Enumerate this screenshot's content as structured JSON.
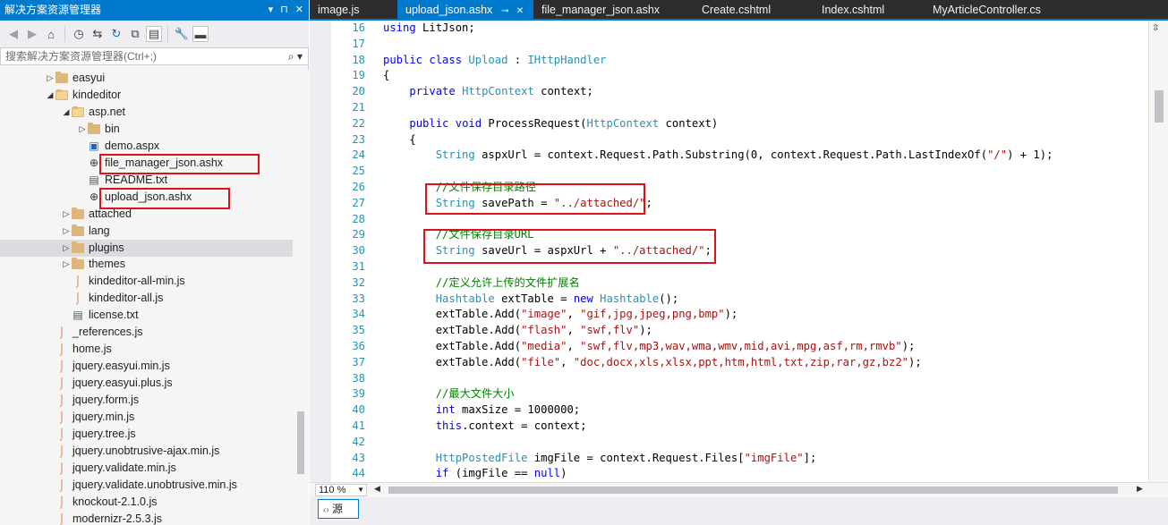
{
  "solution_explorer": {
    "title": "解决方案资源管理器",
    "title_buttons": [
      "▾",
      "⊓",
      "✕"
    ],
    "search_placeholder": "搜索解决方案资源管理器(Ctrl+;)",
    "tree": [
      {
        "label": "easyui",
        "kind": "folder",
        "indent": 3,
        "arrow": "▷"
      },
      {
        "label": "kindeditor",
        "kind": "folder-open",
        "indent": 3,
        "arrow": "◢"
      },
      {
        "label": "asp.net",
        "kind": "folder-open",
        "indent": 4,
        "arrow": "◢"
      },
      {
        "label": "bin",
        "kind": "folder",
        "indent": 5,
        "arrow": "▷"
      },
      {
        "label": "demo.aspx",
        "kind": "aspx",
        "indent": 5,
        "arrow": ""
      },
      {
        "label": "file_manager_json.ashx",
        "kind": "ashx",
        "indent": 5,
        "arrow": "",
        "highlight": true
      },
      {
        "label": "README.txt",
        "kind": "txt",
        "indent": 5,
        "arrow": ""
      },
      {
        "label": "upload_json.ashx",
        "kind": "ashx",
        "indent": 5,
        "arrow": "",
        "highlight": true
      },
      {
        "label": "attached",
        "kind": "folder",
        "indent": 4,
        "arrow": "▷"
      },
      {
        "label": "lang",
        "kind": "folder",
        "indent": 4,
        "arrow": "▷"
      },
      {
        "label": "plugins",
        "kind": "folder",
        "indent": 4,
        "arrow": "▷",
        "selected": true
      },
      {
        "label": "themes",
        "kind": "folder",
        "indent": 4,
        "arrow": "▷"
      },
      {
        "label": "kindeditor-all-min.js",
        "kind": "js",
        "indent": 4,
        "arrow": ""
      },
      {
        "label": "kindeditor-all.js",
        "kind": "js",
        "indent": 4,
        "arrow": ""
      },
      {
        "label": "license.txt",
        "kind": "txt",
        "indent": 4,
        "arrow": ""
      },
      {
        "label": "_references.js",
        "kind": "js",
        "indent": 3,
        "arrow": ""
      },
      {
        "label": "home.js",
        "kind": "js",
        "indent": 3,
        "arrow": ""
      },
      {
        "label": "jquery.easyui.min.js",
        "kind": "js",
        "indent": 3,
        "arrow": ""
      },
      {
        "label": "jquery.easyui.plus.js",
        "kind": "js",
        "indent": 3,
        "arrow": ""
      },
      {
        "label": "jquery.form.js",
        "kind": "js",
        "indent": 3,
        "arrow": ""
      },
      {
        "label": "jquery.min.js",
        "kind": "js",
        "indent": 3,
        "arrow": ""
      },
      {
        "label": "jquery.tree.js",
        "kind": "js",
        "indent": 3,
        "arrow": ""
      },
      {
        "label": "jquery.unobtrusive-ajax.min.js",
        "kind": "js",
        "indent": 3,
        "arrow": ""
      },
      {
        "label": "jquery.validate.min.js",
        "kind": "js",
        "indent": 3,
        "arrow": ""
      },
      {
        "label": "jquery.validate.unobtrusive.min.js",
        "kind": "js",
        "indent": 3,
        "arrow": ""
      },
      {
        "label": "knockout-2.1.0.js",
        "kind": "js",
        "indent": 3,
        "arrow": ""
      },
      {
        "label": "modernizr-2.5.3.js",
        "kind": "js",
        "indent": 3,
        "arrow": ""
      }
    ]
  },
  "editor": {
    "tabs": [
      {
        "label": "image.js",
        "active": false
      },
      {
        "label": "upload_json.ashx",
        "active": true,
        "pin": "⊸",
        "close": "✕"
      },
      {
        "label": "file_manager_json.ashx",
        "active": false
      },
      {
        "label": "Create.cshtml",
        "active": false
      },
      {
        "label": "Index.cshtml",
        "active": false
      },
      {
        "label": "MyArticleController.cs",
        "active": false
      }
    ],
    "line_numbers": [
      "16",
      "17",
      "18",
      "19",
      "20",
      "21",
      "22",
      "23",
      "24",
      "25",
      "26",
      "27",
      "28",
      "29",
      "30",
      "31",
      "32",
      "33",
      "34",
      "35",
      "36",
      "37",
      "38",
      "39",
      "40",
      "41",
      "42",
      "43",
      "44"
    ],
    "code_lines": [
      "using LitJson;",
      "",
      "public class Upload : IHttpHandler",
      "{",
      "    private HttpContext context;",
      "",
      "    public void ProcessRequest(HttpContext context)",
      "    {",
      "        String aspxUrl = context.Request.Path.Substring(0, context.Request.Path.LastIndexOf(\"/\") + 1);",
      "",
      "        //文件保存目录路径",
      "        String savePath = \"../attached/\";",
      "",
      "        //文件保存目录URL",
      "        String saveUrl = aspxUrl + \"../attached/\";",
      "",
      "        //定义允许上传的文件扩展名",
      "        Hashtable extTable = new Hashtable();",
      "        extTable.Add(\"image\", \"gif,jpg,jpeg,png,bmp\");",
      "        extTable.Add(\"flash\", \"swf,flv\");",
      "        extTable.Add(\"media\", \"swf,flv,mp3,wav,wma,wmv,mid,avi,mpg,asf,rm,rmvb\");",
      "        extTable.Add(\"file\", \"doc,docx,xls,xlsx,ppt,htm,html,txt,zip,rar,gz,bz2\");",
      "",
      "        //最大文件大小",
      "        int maxSize = 1000000;",
      "        this.context = context;",
      "",
      "        HttpPostedFile imgFile = context.Request.Files[\"imgFile\"];",
      "        if (imgFile == null)"
    ],
    "zoom": "110 %",
    "view_button": "源",
    "view_icon": "‹›"
  }
}
